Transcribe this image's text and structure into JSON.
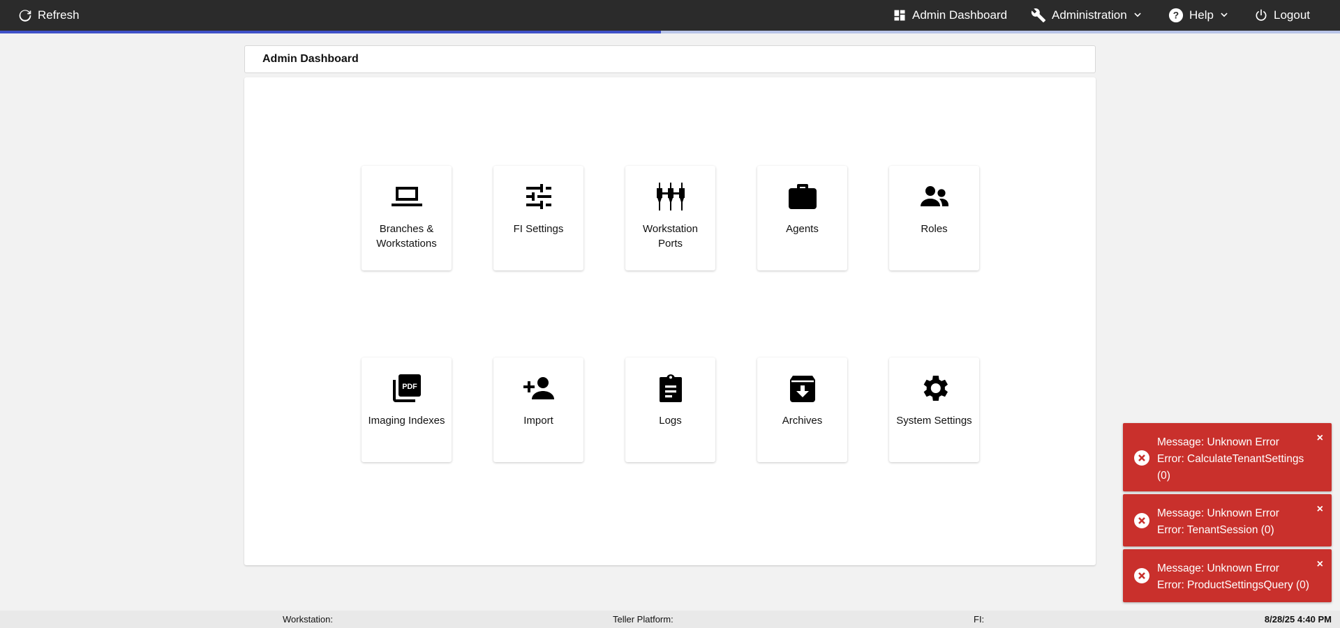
{
  "topbar": {
    "refresh_label": "Refresh",
    "admin_dashboard_label": "Admin Dashboard",
    "administration_label": "Administration",
    "help_label": "Help",
    "logout_label": "Logout"
  },
  "progress": {
    "fraction": 0.493,
    "color": "#3f51c8"
  },
  "page": {
    "title": "Admin Dashboard"
  },
  "tiles": [
    {
      "label": "Branches & Workstations",
      "icon": "laptop-icon"
    },
    {
      "label": "FI Settings",
      "icon": "sliders-icon"
    },
    {
      "label": "Workstation Ports",
      "icon": "ports-icon"
    },
    {
      "label": "Agents",
      "icon": "briefcase-icon"
    },
    {
      "label": "Roles",
      "icon": "people-icon"
    },
    {
      "label": "Imaging Indexes",
      "icon": "pdf-icon"
    },
    {
      "label": "Import",
      "icon": "add-person-icon"
    },
    {
      "label": "Logs",
      "icon": "clipboard-icon"
    },
    {
      "label": "Archives",
      "icon": "archive-icon"
    },
    {
      "label": "System Settings",
      "icon": "gear-icon"
    }
  ],
  "toasts": [
    {
      "message": "Message: Unknown Error",
      "error": "Error: CalculateTenantSettings (0)",
      "close": "×"
    },
    {
      "message": "Message: Unknown Error",
      "error": "Error: TenantSession (0)",
      "close": "×"
    },
    {
      "message": "Message: Unknown Error",
      "error": "Error: ProductSettingsQuery (0)",
      "close": "×"
    }
  ],
  "footer": {
    "workstation_label": "Workstation:",
    "teller_platform_label": "Teller Platform:",
    "fi_label": "FI:",
    "datetime": "8/28/25 4:40 PM"
  },
  "colors": {
    "topbar": "#2b2b2b",
    "toast": "#c9302c",
    "accent": "#3f51c8"
  }
}
